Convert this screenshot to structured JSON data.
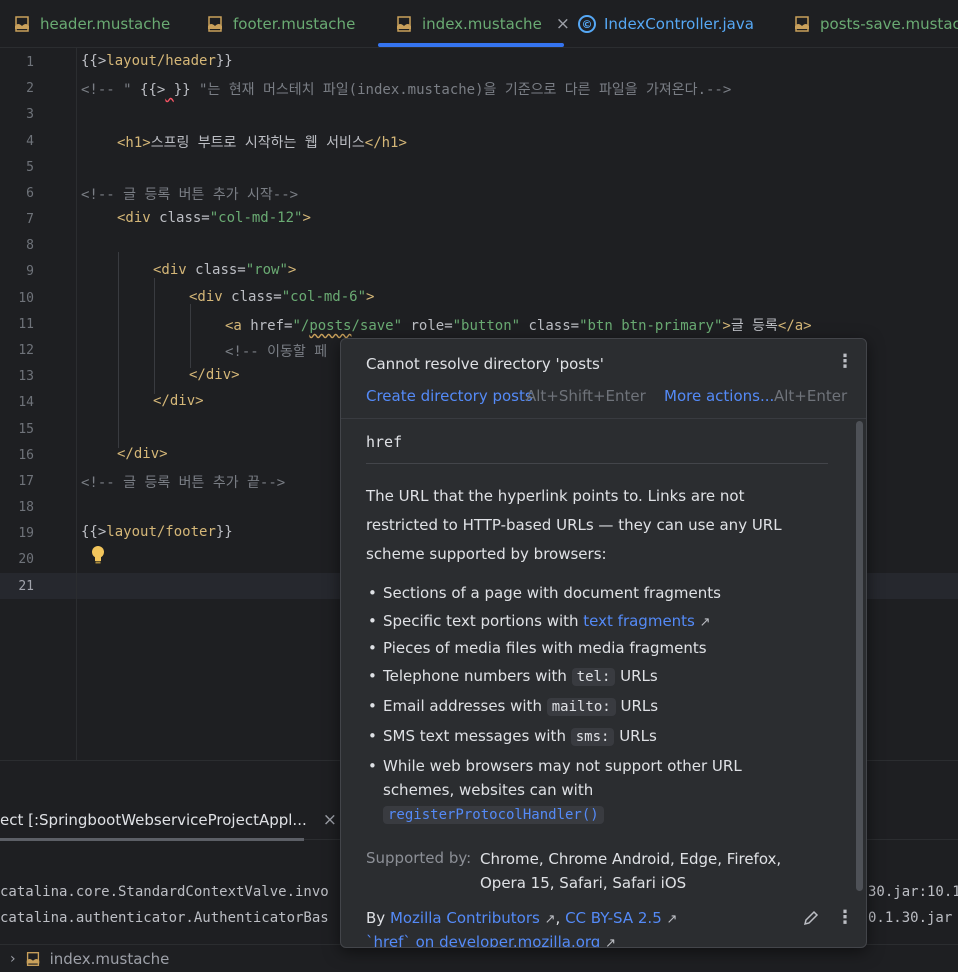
{
  "tabs": [
    {
      "label": "header.mustache",
      "icon": "mustache-file-icon"
    },
    {
      "label": "footer.mustache",
      "icon": "mustache-file-icon"
    },
    {
      "label": "index.mustache",
      "icon": "mustache-file-icon",
      "active": true,
      "close": "×"
    },
    {
      "label": "IndexController.java",
      "icon": "java-class-icon",
      "icon_glyph": "©"
    },
    {
      "label": "posts-save.mustache",
      "icon": "mustache-file-icon"
    }
  ],
  "editor": {
    "line_numbers": [
      "1",
      "2",
      "3",
      "4",
      "5",
      "6",
      "7",
      "8",
      "9",
      "10",
      "11",
      "12",
      "13",
      "14",
      "15",
      "16",
      "17",
      "18",
      "19",
      "20",
      "21"
    ],
    "line1": {
      "open": "{{>",
      "path": "layout/header",
      "close": "}}"
    },
    "line2": {
      "p1": "<!-- \" ",
      "p2": "{{>",
      "p3": " ",
      "p4": "}}",
      "p5": " \"는 현재 머스테치 파일(index.mustache)을 기준으로 다른 파일을 가져온다.-->"
    },
    "line4": {
      "open": "<h1>",
      "text": "스프링 부트로 시작하는 웹 서비스",
      "close": "</h1>"
    },
    "line6": "<!-- 글 등록 버튼 추가 시작-->",
    "line7": {
      "tag": "<div ",
      "attr": "class=",
      "val": "\"col-md-12\"",
      "end": ">"
    },
    "line9": {
      "tag": "<div ",
      "attr": "class=",
      "val": "\"row\"",
      "end": ">"
    },
    "line10": {
      "tag": "<div ",
      "attr": "class=",
      "val": "\"col-md-6\"",
      "end": ">"
    },
    "line11": {
      "tag": "<a ",
      "a1": "href=",
      "v1a": "\"/",
      "v1b": "posts",
      "v1c": "/save\"",
      "a2": " role=",
      "v2": "\"button\"",
      "a3": " class=",
      "v3": "\"btn btn-primary\"",
      "end": ">",
      "text": "글 등록",
      "close": "</a>"
    },
    "line12": "<!-- 이동할 페",
    "line13": "</div>",
    "line14": "</div>",
    "line16": "</div>",
    "line17": "<!-- 글 등록 버튼 추가 끝-->",
    "line19": {
      "open": "{{>",
      "path": "layout/footer",
      "close": "}}"
    }
  },
  "run_panel": {
    "tab_label": "ect [:SpringbootWebserviceProjectAppl...",
    "close": "×",
    "console": [
      {
        "left": "catalina.core.StandardContextValve.invo",
        "right": "30.jar:10.1"
      },
      {
        "left": "catalina.authenticator.AuthenticatorBas",
        "right": "0.1.30.jar"
      }
    ]
  },
  "breadcrumb": {
    "chevron": "›",
    "file": "index.mustache"
  },
  "popup": {
    "error": "Cannot resolve directory 'posts'",
    "kebab": "⋮",
    "action1": {
      "label": "Create directory posts",
      "shortcut": "Alt+Shift+Enter"
    },
    "action2": {
      "label": "More actions...",
      "shortcut": "Alt+Enter"
    },
    "doc_title": "href",
    "description": "The URL that the hyperlink points to. Links are not restricted to HTTP-based URLs — they can use any URL scheme supported by browsers:",
    "bullets": {
      "b1": "Sections of a page with document fragments",
      "b2_pre": "Specific text portions with ",
      "b2_link": "text fragments",
      "b3": "Pieces of media files with media fragments",
      "b4_pre": "Telephone numbers with ",
      "b4_code": "tel:",
      "b4_post": " URLs",
      "b5_pre": "Email addresses with ",
      "b5_code": "mailto:",
      "b5_post": " URLs",
      "b6_pre": "SMS text messages with ",
      "b6_code": "sms:",
      "b6_post": " URLs",
      "b7_pre": "While web browsers may not support other URL schemes, websites can with ",
      "b7_code": "registerProtocolHandler()"
    },
    "bullet_glyph": "•",
    "ext_glyph": "↗",
    "supported_label": "Supported by:",
    "supported_value": "Chrome, Chrome Android, Edge, Firefox, Opera 15, Safari, Safari iOS",
    "by_prefix": "By ",
    "by_author": "Mozilla Contributors",
    "by_sep": ", ",
    "by_license": "CC BY-SA 2.5",
    "mdn_link": "`href` on developer.mozilla.org"
  },
  "colors": {
    "accent": "#3574f0",
    "link": "#548af7",
    "tag": "#d5b778",
    "string": "#6aab73",
    "comment": "#7a7e85"
  }
}
